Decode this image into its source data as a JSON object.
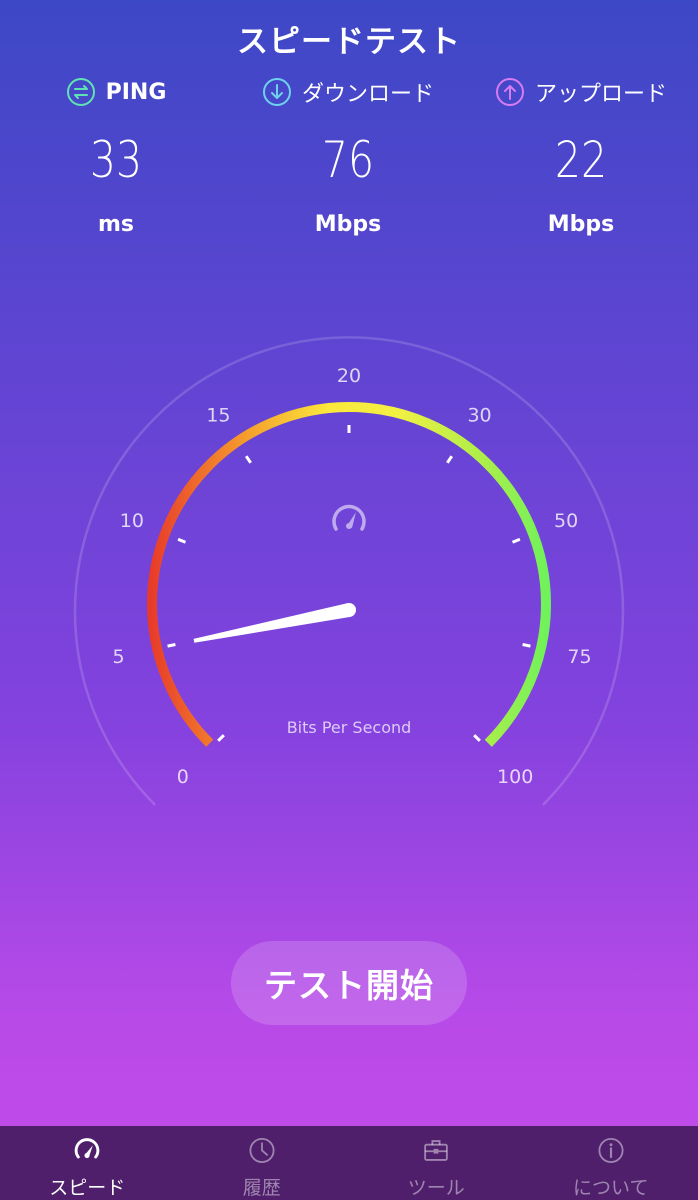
{
  "header": {
    "title": "スピードテスト"
  },
  "metrics": {
    "ping": {
      "label": "PING",
      "value": "33",
      "unit": "ms",
      "color": "#5fe3b0"
    },
    "download": {
      "label": "ダウンロード",
      "value": "76",
      "unit": "Mbps",
      "color": "#6fd2ec"
    },
    "upload": {
      "label": "アップロード",
      "value": "22",
      "unit": "Mbps",
      "color": "#d77bf2"
    }
  },
  "gauge": {
    "tick_labels": [
      "0",
      "5",
      "10",
      "15",
      "20",
      "30",
      "50",
      "75",
      "100"
    ],
    "caption": "Bits Per Second",
    "needle_value": "5",
    "center_icon": "speedometer-icon"
  },
  "actions": {
    "start_label": "テスト開始"
  },
  "tabbar": {
    "active": "speed",
    "items": [
      {
        "id": "speed",
        "label": "スピード",
        "icon": "speedometer-icon"
      },
      {
        "id": "history",
        "label": "履歴",
        "icon": "clock-icon"
      },
      {
        "id": "tools",
        "label": "ツール",
        "icon": "toolbox-icon"
      },
      {
        "id": "about",
        "label": "について",
        "icon": "info-icon"
      }
    ]
  }
}
